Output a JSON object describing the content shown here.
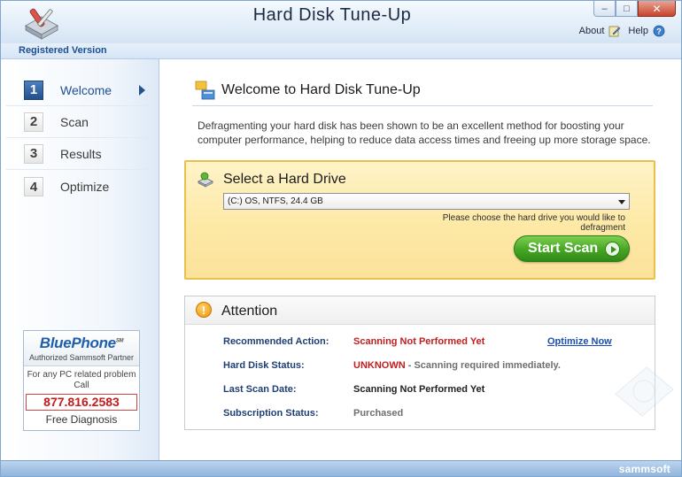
{
  "window": {
    "title": "Hard Disk Tune-Up",
    "controls": {
      "minimize": "–",
      "maximize": "□",
      "close": "✕"
    },
    "links": {
      "about": "About",
      "help": "Help"
    }
  },
  "registration": "Registered Version",
  "sidebar": {
    "steps": [
      {
        "num": "1",
        "label": "Welcome",
        "active": true
      },
      {
        "num": "2",
        "label": "Scan",
        "active": false
      },
      {
        "num": "3",
        "label": "Results",
        "active": false
      },
      {
        "num": "4",
        "label": "Optimize",
        "active": false
      }
    ],
    "bluephone": {
      "logo": "BluePhone",
      "tm": "SM",
      "subtitle": "Authorized Sammsoft Partner",
      "text": "For any PC related problem Call",
      "phone": "877.816.2583",
      "free": "Free Diagnosis"
    }
  },
  "main": {
    "welcome_title": "Welcome to Hard Disk Tune-Up",
    "intro": "Defragmenting your hard disk has been shown to be an excellent method for boosting your computer performance, helping to reduce data access times and freeing up more storage space.",
    "drive": {
      "title": "Select a Hard Drive",
      "selected": "(C:) OS, NTFS, 24.4 GB",
      "hint": "Please choose the hard drive you would like to defragment",
      "start_button": "Start Scan"
    },
    "attention": {
      "title": "Attention",
      "recommended_label": "Recommended Action:",
      "recommended_value": "Scanning Not Performed Yet",
      "optimize_link": "Optimize Now",
      "status_label": "Hard Disk Status:",
      "status_value": "UNKNOWN",
      "status_detail": " - Scanning required immediately.",
      "lastscan_label": "Last Scan Date:",
      "lastscan_value": "Scanning Not Performed Yet",
      "subscription_label": "Subscription Status:",
      "subscription_value": "Purchased"
    }
  },
  "footer": {
    "brand": "sammsoft"
  },
  "colors": {
    "accent_blue": "#1c4f91",
    "alert_red": "#c21d1d",
    "button_green": "#4aa827",
    "panel_yellow": "#fde9a6"
  }
}
